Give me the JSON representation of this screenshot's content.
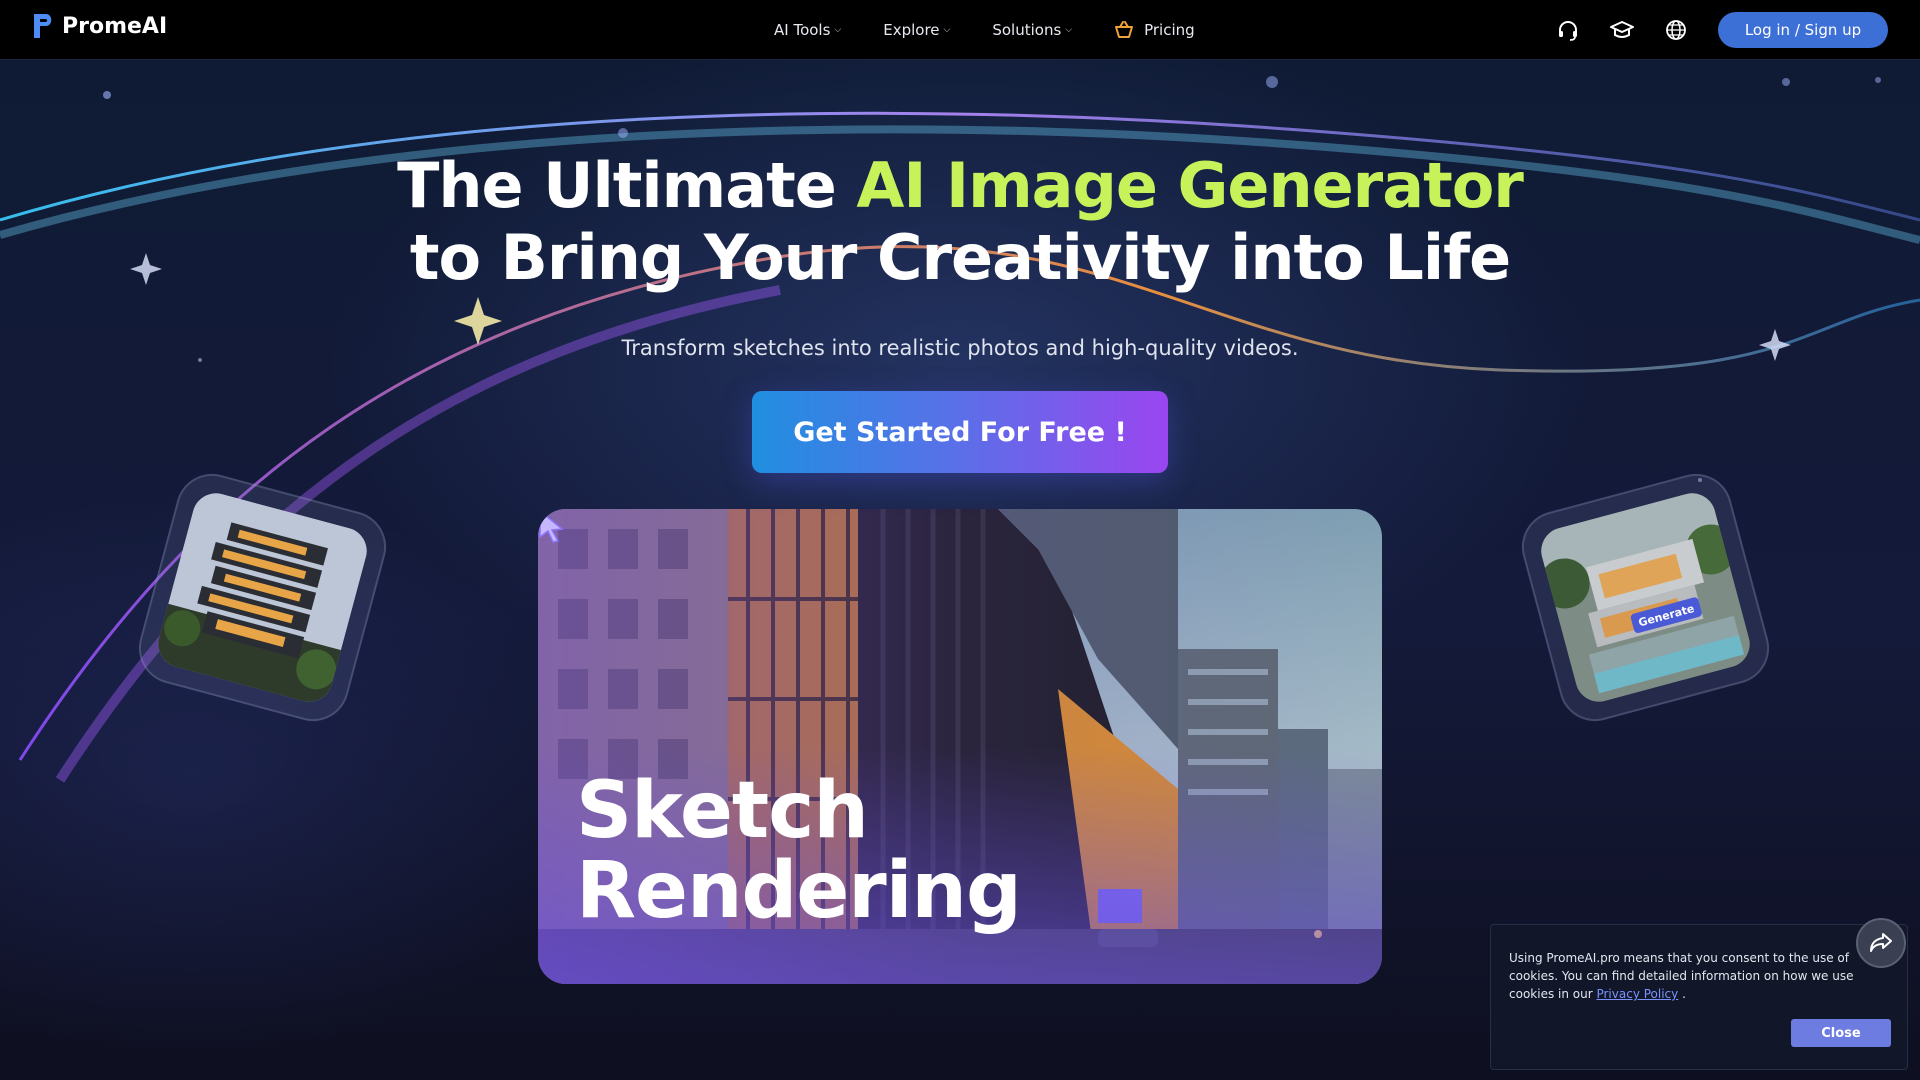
{
  "brand": {
    "name": "PromeAI"
  },
  "nav": {
    "items": [
      {
        "label": "AI Tools"
      },
      {
        "label": "Explore"
      },
      {
        "label": "Solutions"
      }
    ],
    "pricing_label": "Pricing",
    "icons": [
      "headset-icon",
      "graduation-cap-icon",
      "globe-icon"
    ],
    "login_label": "Log in / Sign up"
  },
  "hero": {
    "headline_part1": "The Ultimate ",
    "headline_accent": "AI Image Generator",
    "headline_line2": "to Bring Your Creativity into Life",
    "subtitle": "Transform sketches into realistic photos and high-quality videos.",
    "cta_label": "Get Started For Free !",
    "card_caption_line1": "Sketch",
    "card_caption_line2": "Rendering",
    "right_thumb_button": "Generate"
  },
  "cookie": {
    "text_before": "Using PromeAI.pro means that you consent to the use of cookies. You can find detailed information on how we use cookies in our ",
    "link_label": "Privacy Policy",
    "text_after": " .",
    "close_label": "Close"
  },
  "colors": {
    "accent": "#c7f25a",
    "login_button": "#3d70d6",
    "cta_start": "#1f8fe0",
    "cta_end": "#9a46f0",
    "cookie_close": "#6c7ce0"
  }
}
